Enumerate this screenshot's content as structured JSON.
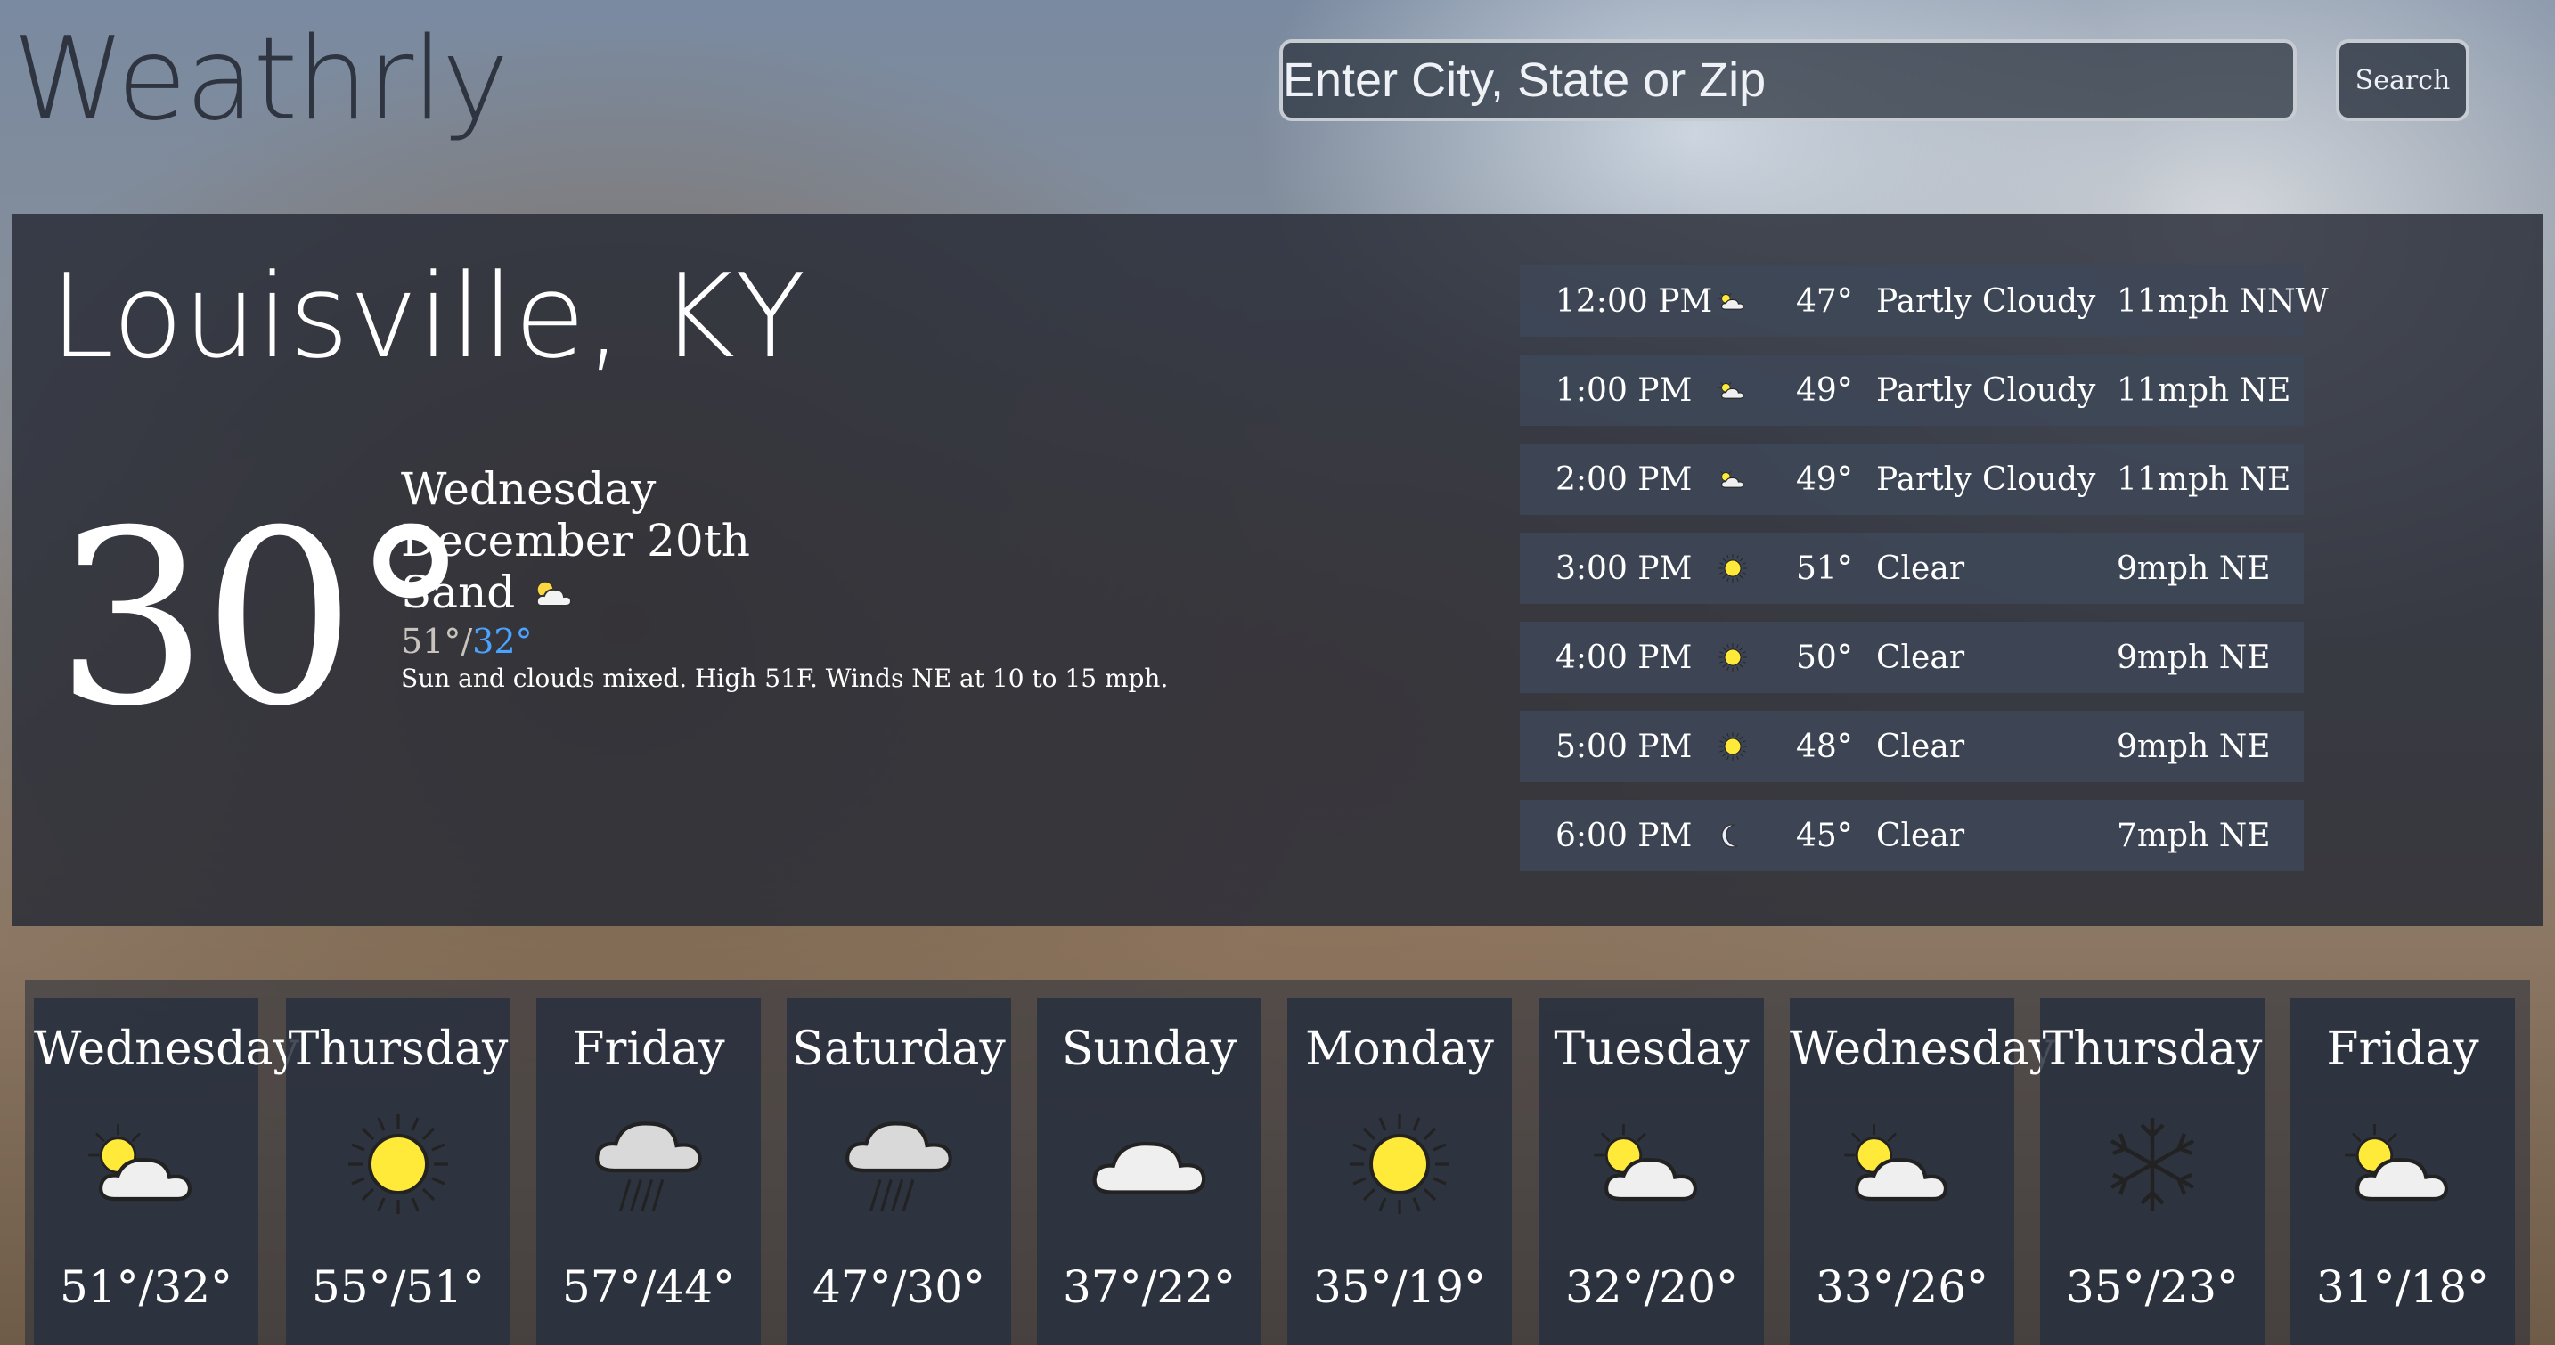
{
  "app": {
    "logo": "Weathrly"
  },
  "search": {
    "placeholder": "Enter City, State or Zip",
    "button_label": "Search"
  },
  "current": {
    "city": "Louisville, KY",
    "temperature": "30°",
    "day": "Wednesday",
    "date": "December 20th",
    "condition": "Sand",
    "condition_icon": "partly-cloudy-icon",
    "high": "51°",
    "separator": "/",
    "low": "32°",
    "summary": "Sun and clouds mixed. High 51F. Winds NE at 10 to 15 mph."
  },
  "hourly": [
    {
      "time": "12:00 PM",
      "icon": "partly-cloudy-icon",
      "temp": "47°",
      "condition": "Partly Cloudy",
      "wind": "11mph NNW"
    },
    {
      "time": "1:00 PM",
      "icon": "partly-cloudy-icon",
      "temp": "49°",
      "condition": "Partly Cloudy",
      "wind": "11mph NE"
    },
    {
      "time": "2:00 PM",
      "icon": "partly-cloudy-icon",
      "temp": "49°",
      "condition": "Partly Cloudy",
      "wind": "11mph NE"
    },
    {
      "time": "3:00 PM",
      "icon": "sun-icon",
      "temp": "51°",
      "condition": "Clear",
      "wind": "9mph NE"
    },
    {
      "time": "4:00 PM",
      "icon": "sun-icon",
      "temp": "50°",
      "condition": "Clear",
      "wind": "9mph NE"
    },
    {
      "time": "5:00 PM",
      "icon": "sun-icon",
      "temp": "48°",
      "condition": "Clear",
      "wind": "9mph NE"
    },
    {
      "time": "6:00 PM",
      "icon": "moon-icon",
      "temp": "45°",
      "condition": "Clear",
      "wind": "7mph NE"
    }
  ],
  "forecast": [
    {
      "day": "Wednesday",
      "icon": "partly-cloudy-icon",
      "temps": "51°/32°"
    },
    {
      "day": "Thursday",
      "icon": "sun-icon",
      "temps": "55°/51°"
    },
    {
      "day": "Friday",
      "icon": "rain-icon",
      "temps": "57°/44°"
    },
    {
      "day": "Saturday",
      "icon": "rain-icon",
      "temps": "47°/30°"
    },
    {
      "day": "Sunday",
      "icon": "cloud-icon",
      "temps": "37°/22°"
    },
    {
      "day": "Monday",
      "icon": "sun-icon",
      "temps": "35°/19°"
    },
    {
      "day": "Tuesday",
      "icon": "partly-cloudy-icon",
      "temps": "32°/20°"
    },
    {
      "day": "Wednesday",
      "icon": "partly-cloudy-icon",
      "temps": "33°/26°"
    },
    {
      "day": "Thursday",
      "icon": "snow-icon",
      "temps": "35°/23°"
    },
    {
      "day": "Friday",
      "icon": "partly-cloudy-icon",
      "temps": "31°/18°"
    }
  ],
  "colors": {
    "low_temp": "#4aa3ff",
    "panel": "#262a34",
    "row": "#3e4858",
    "text": "#ffffff"
  }
}
